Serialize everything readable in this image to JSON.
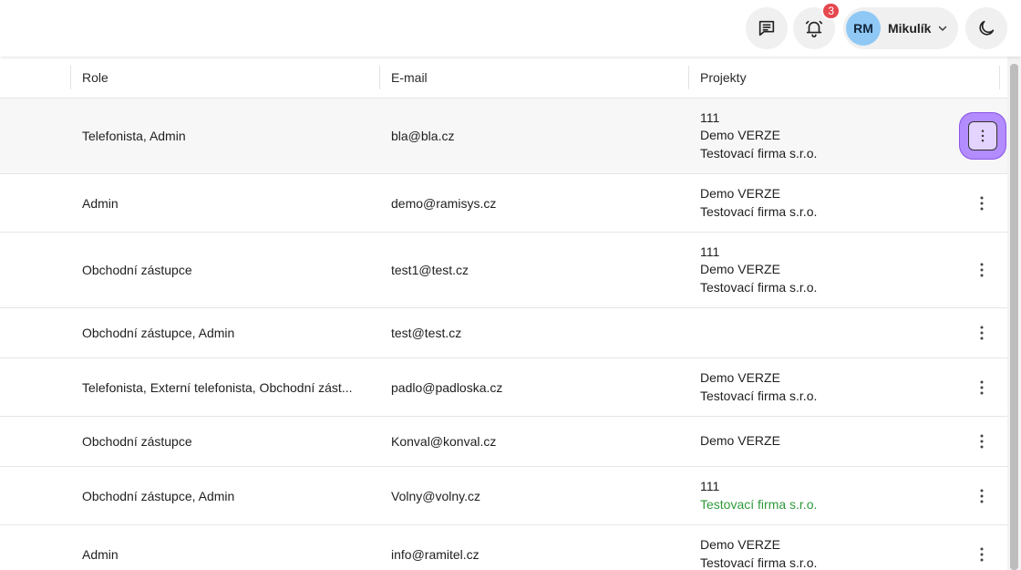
{
  "header": {
    "notifications_count": "3",
    "user_initials": "RM",
    "user_name": "Mikulík"
  },
  "table": {
    "columns": [
      "Role",
      "E-mail",
      "Projekty"
    ],
    "rows": [
      {
        "role": "Telefonista, Admin",
        "email": "bla@bla.cz",
        "projects": [
          "111",
          "Demo VERZE",
          "Testovací firma s.r.o."
        ],
        "selected": true
      },
      {
        "role": "Admin",
        "email": "demo@ramisys.cz",
        "projects": [
          "Demo VERZE",
          "Testovací firma s.r.o."
        ]
      },
      {
        "role": "Obchodní zástupce",
        "email": "test1@test.cz",
        "projects": [
          "111",
          "Demo VERZE",
          "Testovací firma s.r.o."
        ]
      },
      {
        "role": "Obchodní zástupce, Admin",
        "email": "test@test.cz",
        "projects": []
      },
      {
        "role": "Telefonista, Externí telefonista, Obchodní zást...",
        "email": "padlo@padloska.cz",
        "projects": [
          "Demo VERZE",
          "Testovací firma s.r.o."
        ]
      },
      {
        "role": "Obchodní zástupce",
        "email": "Konval@konval.cz",
        "projects": [
          "Demo VERZE"
        ]
      },
      {
        "role": "Obchodní zástupce, Admin",
        "email": "Volny@volny.cz",
        "projects": [
          "111",
          "Testovací firma s.r.o."
        ],
        "highlight_last_project": true
      },
      {
        "role": "Admin",
        "email": "info@ramitel.cz",
        "projects": [
          "Demo VERZE",
          "Testovací firma s.r.o."
        ]
      }
    ]
  },
  "colors": {
    "badge": "#e5484d",
    "avatar": "#8fc8f5",
    "highlight_project": "#2e9a3a",
    "active_menu_ring": "#b38cff"
  }
}
